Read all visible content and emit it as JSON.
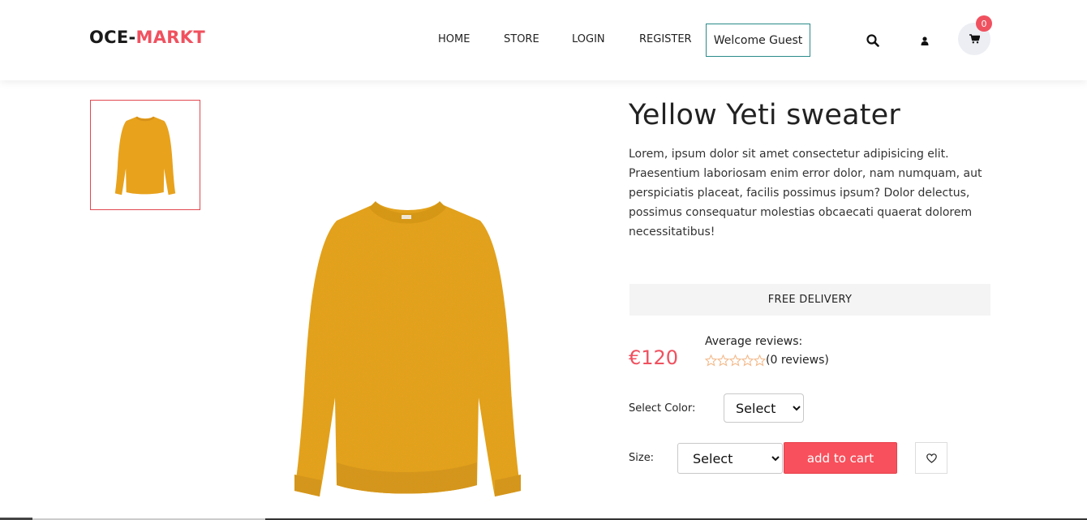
{
  "header": {
    "logo_main": "OCE-",
    "logo_accent": "MARKT",
    "nav": [
      {
        "label": "HOME"
      },
      {
        "label": "STORE"
      },
      {
        "label": "LOGIN"
      },
      {
        "label": "REGISTER"
      }
    ],
    "welcome": "Welcome Guest",
    "cart_count": "0",
    "icons": [
      "search-icon",
      "user-icon",
      "cart-icon"
    ]
  },
  "product": {
    "title": "Yellow Yeti sweater",
    "description": "Lorem, ipsum dolor sit amet consectetur adipisicing elit. Praesentium laboriosam enim error dolor, nam numquam, aut perspiciatis placeat, facilis possimus ipsum? Dolor delectus, possimus consequatur molestias obcaecati quaerat dolorem necessitatibus!",
    "delivery": "FREE DELIVERY",
    "price": "€120",
    "reviews_label": "Average reviews:",
    "reviews_count": "(0 reviews)",
    "rating": 0,
    "rating_max": 5,
    "color_label": "Select Color:",
    "color_selected": "Select",
    "size_label": "Size:",
    "size_selected": "Select",
    "add_to_cart": "add to cart"
  },
  "colors": {
    "accent": "#f0515f",
    "sweater": "#e8a21c",
    "welcome_border": "#2a8a8a",
    "star": "#f3b98a"
  }
}
